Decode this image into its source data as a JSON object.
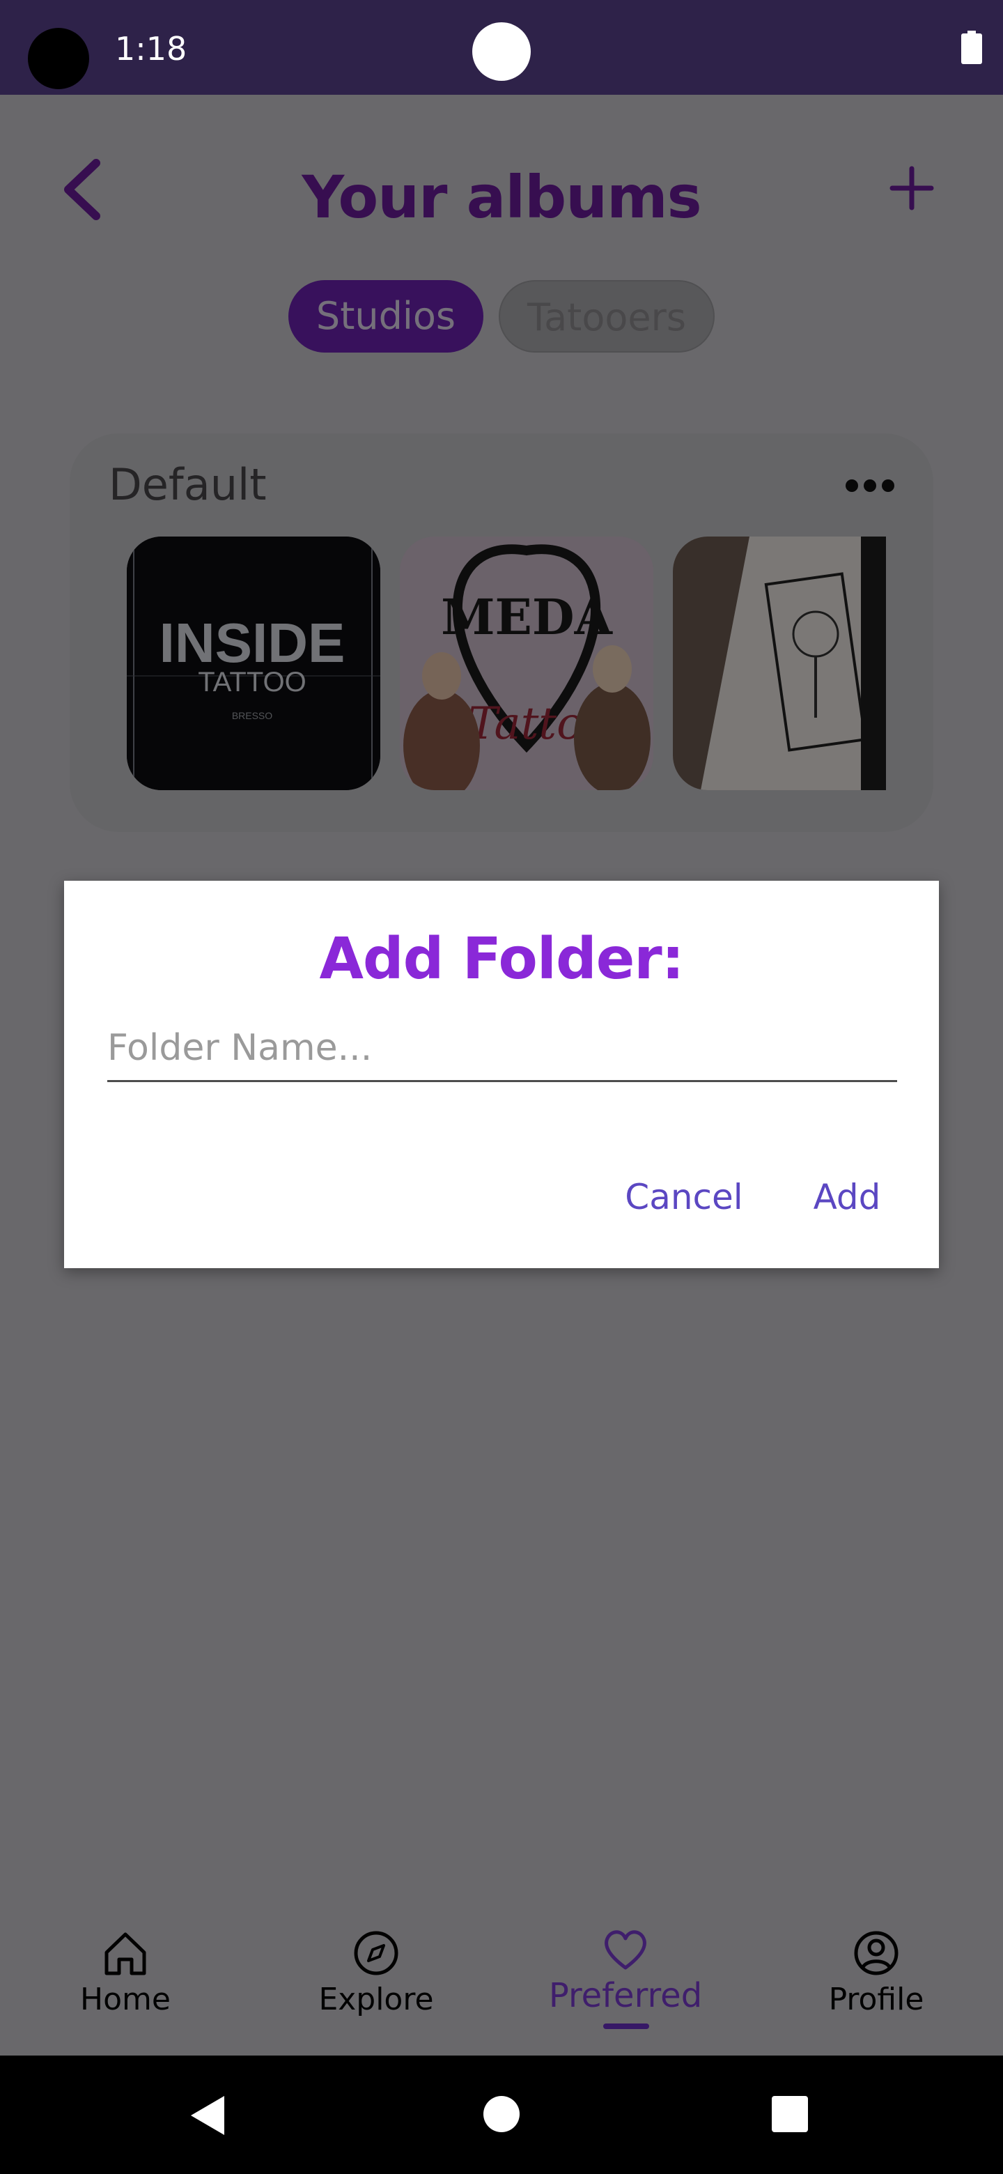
{
  "status_bar": {
    "time": "1:18"
  },
  "header": {
    "title": "Your albums"
  },
  "tabs": [
    {
      "label": "Studios",
      "selected": true
    },
    {
      "label": "Tatooers",
      "selected": false
    }
  ],
  "album": {
    "name": "Default",
    "thumbnails": [
      {
        "line1": "INSIDE",
        "line2": "TATTOO",
        "line3": "BRESSO"
      },
      {
        "line1": "MEDA",
        "line2": "Tattoo"
      },
      {
        "line1": ""
      }
    ]
  },
  "dialog": {
    "title": "Add Folder:",
    "input_placeholder": "Folder Name...",
    "input_value": "",
    "cancel_label": "Cancel",
    "add_label": "Add"
  },
  "bottom_nav": {
    "items": [
      {
        "label": "Home",
        "icon": "home-icon"
      },
      {
        "label": "Explore",
        "icon": "compass-icon"
      },
      {
        "label": "Preferred",
        "icon": "heart-icon",
        "active": true
      },
      {
        "label": "Profile",
        "icon": "profile-icon"
      }
    ]
  },
  "colors": {
    "accent": "#6a1b9a",
    "dialog_title": "#8a28d8",
    "dialog_buttons": "#5b47c2",
    "status_bar": "#2e2249"
  }
}
